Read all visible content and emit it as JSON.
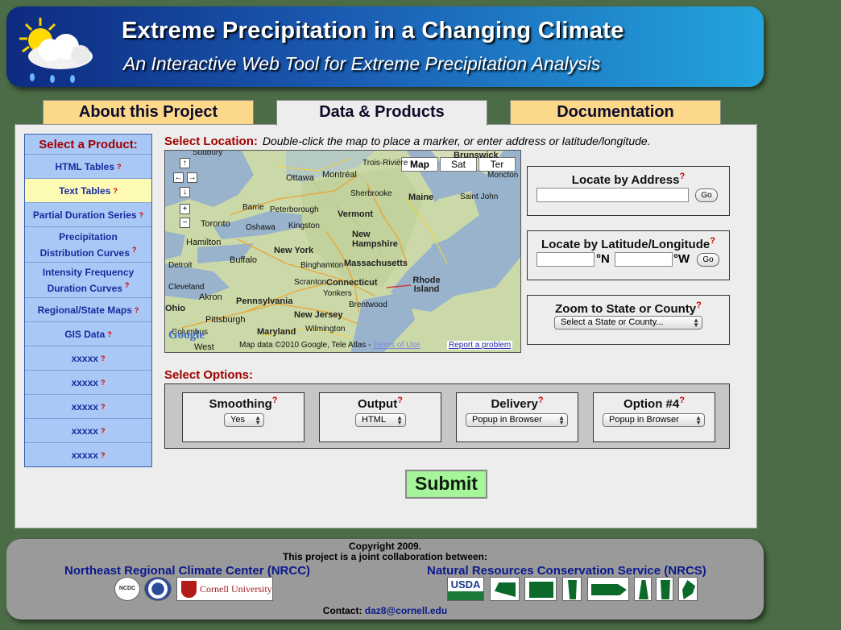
{
  "header": {
    "title": "Extreme Precipitation in a Changing Climate",
    "subtitle": "An Interactive Web Tool for Extreme Precipitation Analysis"
  },
  "tabs": [
    {
      "label": "About this Project",
      "active": false
    },
    {
      "label": "Data & Products",
      "active": true
    },
    {
      "label": "Documentation",
      "active": false
    }
  ],
  "sidebar": {
    "title": "Select a Product:",
    "help": "?",
    "items": [
      {
        "label": "HTML Tables",
        "selected": false
      },
      {
        "label": "Text Tables",
        "selected": true
      },
      {
        "label": "Partial Duration Series",
        "selected": false
      },
      {
        "label_line1": "Precipitation",
        "label_line2": "Distribution Curves",
        "selected": false
      },
      {
        "label_line1": "Intensity Frequency",
        "label_line2": "Duration Curves",
        "selected": false
      },
      {
        "label": "Regional/State Maps",
        "selected": false
      },
      {
        "label": "GIS Data",
        "selected": false
      },
      {
        "label": "xxxxx",
        "selected": false
      },
      {
        "label": "xxxxx",
        "selected": false
      },
      {
        "label": "xxxxx",
        "selected": false
      },
      {
        "label": "xxxxx",
        "selected": false
      },
      {
        "label": "xxxxx",
        "selected": false
      }
    ]
  },
  "location": {
    "label": "Select Location:",
    "instructions": "Double-click the map to place a marker, or enter address or latitude/longitude."
  },
  "map": {
    "types": [
      "Map",
      "Sat",
      "Ter"
    ],
    "selected_type": "Map",
    "attribution": "Map data ©2010 Google, Tele Atlas -",
    "terms": "Terms of Use",
    "report": "Report a problem",
    "google": "Google",
    "cities": [
      "Sudbury",
      "Ottawa",
      "Montréal",
      "Trois-Rivière",
      "Brunswick",
      "Moncton",
      "Sherbrooke",
      "Maine",
      "Saint John",
      "Barrie",
      "Peterborough",
      "Vermont",
      "Toronto",
      "Oshawa",
      "Kingston",
      "New Hampshire",
      "Hamilton",
      "Buffalo",
      "New York",
      "Massachusetts",
      "Detroit",
      "Binghamton",
      "Rhode Island",
      "Connecticut",
      "Scranton",
      "Yonkers",
      "Akron",
      "Pennsylvania",
      "Brentwood",
      "Ohio",
      "New Jersey",
      "Pittsburgh",
      "Columbus",
      "Wilmington",
      "Maryland",
      "West",
      "Cleveland"
    ]
  },
  "locate_address": {
    "title": "Locate by Address",
    "value": "",
    "go": "Go"
  },
  "locate_latlon": {
    "title": "Locate by Latitude/Longitude",
    "lat_value": "",
    "lat_unit": "°N",
    "lon_value": "",
    "lon_unit": "°W",
    "go": "Go"
  },
  "zoom": {
    "title": "Zoom to State or County",
    "select": "Select a State or County..."
  },
  "options": {
    "label": "Select Options:",
    "items": [
      {
        "title": "Smoothing",
        "value": "Yes"
      },
      {
        "title": "Output",
        "value": "HTML"
      },
      {
        "title": "Delivery",
        "value": "Popup in Browser"
      },
      {
        "title": "Option #4",
        "value": "Popup in Browser"
      }
    ]
  },
  "submit": "Submit",
  "footer": {
    "copyright": "Copyright 2009.",
    "collab": "This project is a joint collaboration between:",
    "org_left": "Northeast Regional Climate Center (NRCC)",
    "org_right": "Natural Resources Conservation Service (NRCS)",
    "logo_ncdc": "NCDC",
    "logo_cornell": "Cornell University",
    "logo_usda": "USDA",
    "contact_label": "Contact:",
    "contact_email": "daz8@cornell.edu"
  },
  "colors": {
    "accent_red": "#a00000",
    "link_blue": "#1a2aa0",
    "tab_gold": "#fcd88a",
    "sidebar_blue": "#a9c8f5",
    "submit_green": "#a7f59b"
  }
}
